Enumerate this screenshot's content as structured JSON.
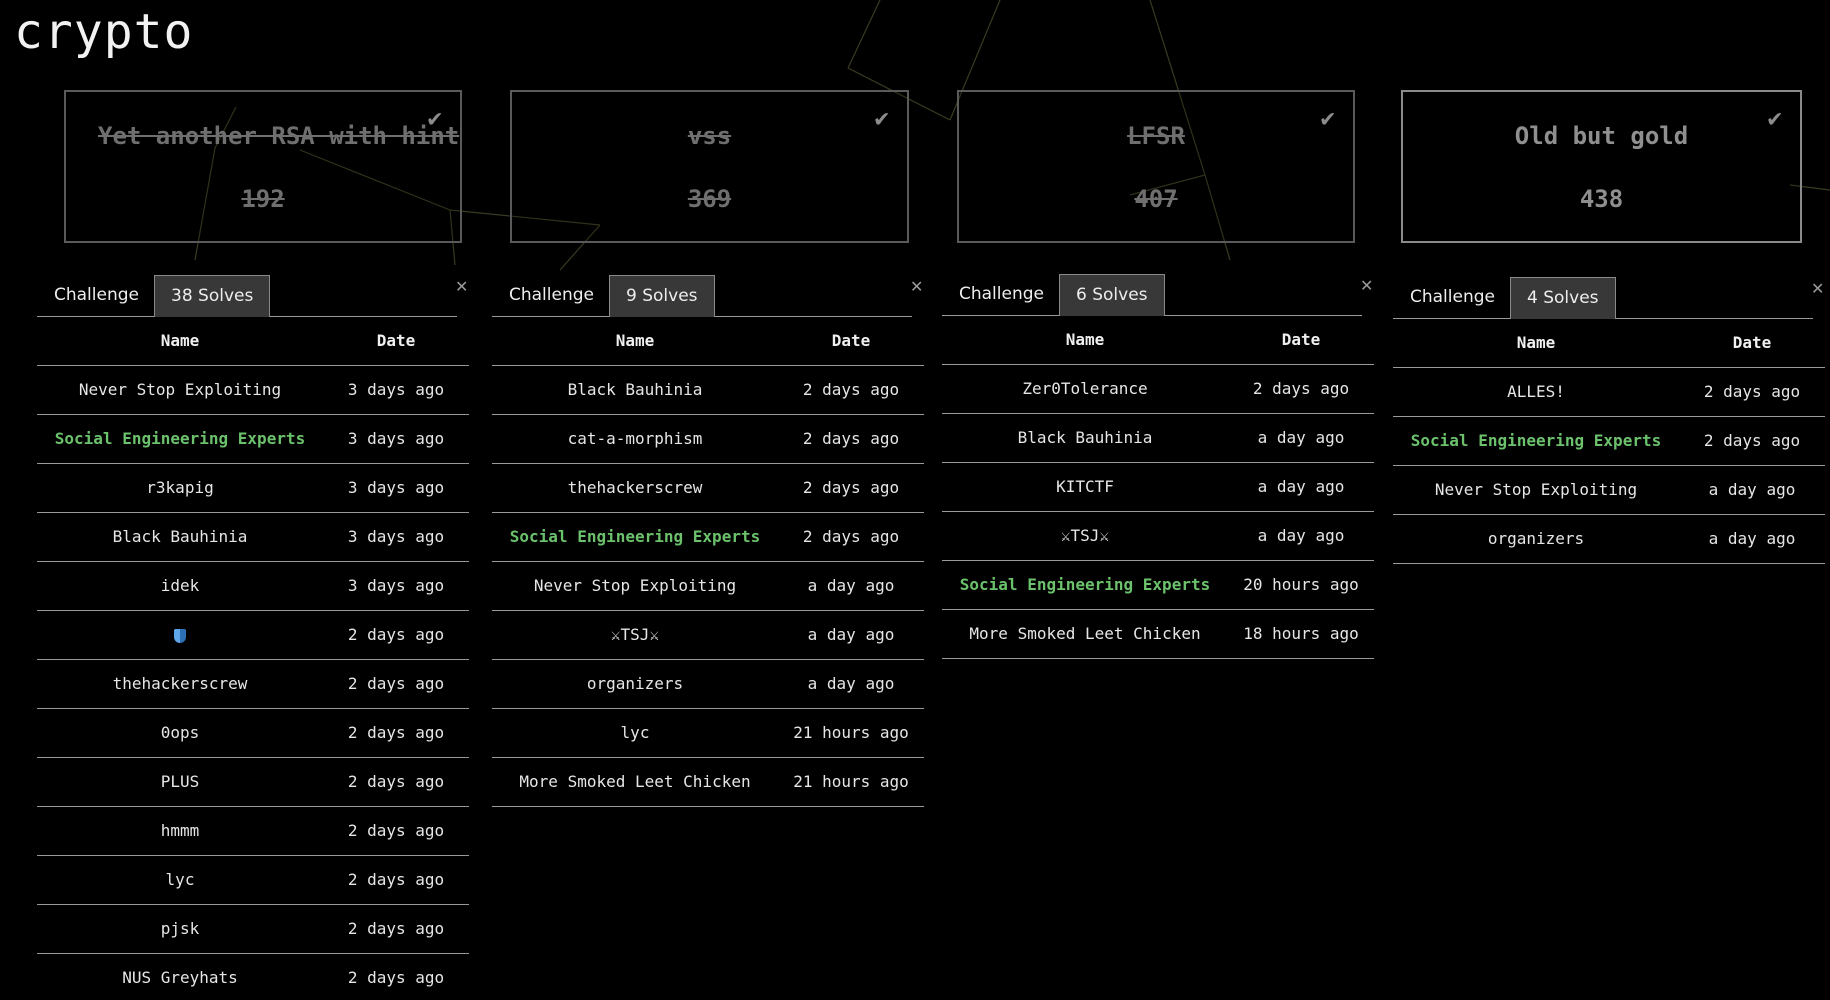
{
  "category": "crypto",
  "check_icon": "check-icon",
  "cards": [
    {
      "name": "Yet another RSA with hint",
      "points": "192",
      "solved": true
    },
    {
      "name": "vss",
      "points": "369",
      "solved": true
    },
    {
      "name": "LFSR",
      "points": "407",
      "solved": true
    },
    {
      "name": "Old but gold",
      "points": "438",
      "solved": false
    }
  ],
  "highlight_color": "#6cc26c",
  "panels": [
    {
      "tab_challenge": "Challenge",
      "tab_solves": "38 Solves",
      "close": "✕",
      "col_name": "Name",
      "col_date": "Date",
      "rows": [
        {
          "name": "Never Stop Exploiting",
          "date": "3 days ago"
        },
        {
          "name": "Social Engineering Experts",
          "date": "3 days ago",
          "highlight": true
        },
        {
          "name": "r3kapig",
          "date": "3 days ago"
        },
        {
          "name": "Black Bauhinia",
          "date": "3 days ago"
        },
        {
          "name": "idek",
          "date": "3 days ago"
        },
        {
          "name": "",
          "icon": "shield-icon",
          "date": "2 days ago"
        },
        {
          "name": "thehackerscrew",
          "date": "2 days ago"
        },
        {
          "name": "0ops",
          "date": "2 days ago"
        },
        {
          "name": "PLUS",
          "date": "2 days ago"
        },
        {
          "name": "hmmm",
          "date": "2 days ago"
        },
        {
          "name": "lyc",
          "date": "2 days ago"
        },
        {
          "name": "pjsk",
          "date": "2 days ago"
        },
        {
          "name": "NUS Greyhats",
          "date": "2 days ago"
        }
      ]
    },
    {
      "tab_challenge": "Challenge",
      "tab_solves": "9 Solves",
      "close": "✕",
      "col_name": "Name",
      "col_date": "Date",
      "rows": [
        {
          "name": "Black Bauhinia",
          "date": "2 days ago"
        },
        {
          "name": "cat-a-morphism",
          "date": "2 days ago"
        },
        {
          "name": "thehackerscrew",
          "date": "2 days ago"
        },
        {
          "name": "Social Engineering Experts",
          "date": "2 days ago",
          "highlight": true
        },
        {
          "name": "Never Stop Exploiting",
          "date": "a day ago"
        },
        {
          "name": "⚔TSJ⚔",
          "date": "a day ago"
        },
        {
          "name": "organizers",
          "date": "a day ago"
        },
        {
          "name": "lyc",
          "date": "21 hours ago"
        },
        {
          "name": "More Smoked Leet Chicken",
          "date": "21 hours ago"
        }
      ]
    },
    {
      "tab_challenge": "Challenge",
      "tab_solves": "6 Solves",
      "close": "✕",
      "col_name": "Name",
      "col_date": "Date",
      "rows": [
        {
          "name": "Zer0Tolerance",
          "date": "2 days ago"
        },
        {
          "name": "Black Bauhinia",
          "date": "a day ago"
        },
        {
          "name": "KITCTF",
          "date": "a day ago"
        },
        {
          "name": "⚔TSJ⚔",
          "date": "a day ago"
        },
        {
          "name": "Social Engineering Experts",
          "date": "20 hours ago",
          "highlight": true
        },
        {
          "name": "More Smoked Leet Chicken",
          "date": "18 hours ago"
        }
      ]
    },
    {
      "tab_challenge": "Challenge",
      "tab_solves": "4 Solves",
      "close": "✕",
      "col_name": "Name",
      "col_date": "Date",
      "rows": [
        {
          "name": "ALLES!",
          "date": "2 days ago"
        },
        {
          "name": "Social Engineering Experts",
          "date": "2 days ago",
          "highlight": true
        },
        {
          "name": "Never Stop Exploiting",
          "date": "a day ago"
        },
        {
          "name": "organizers",
          "date": "a day ago"
        }
      ]
    }
  ]
}
